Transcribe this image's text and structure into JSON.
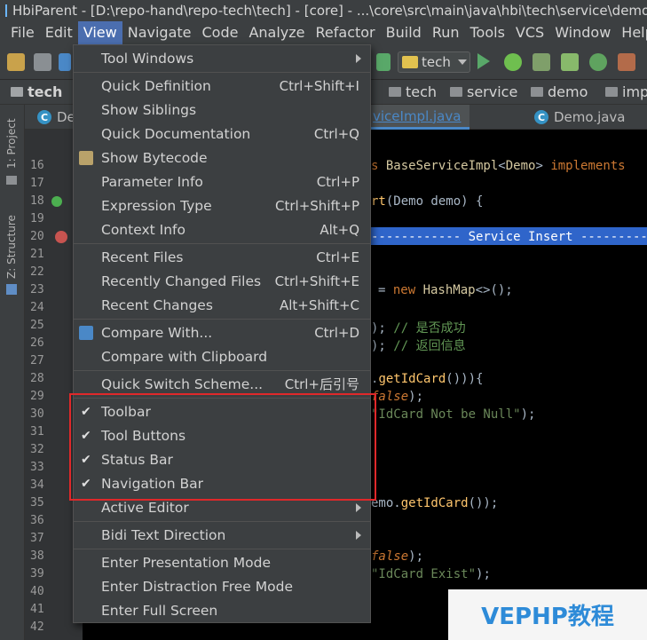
{
  "window": {
    "title": "HbiParent - [D:\\repo-hand\\repo-tech\\tech] - [core] - ...\\core\\src\\main\\java\\hbi\\tech\\service\\demo"
  },
  "menubar": [
    "File",
    "Edit",
    "View",
    "Navigate",
    "Code",
    "Analyze",
    "Refactor",
    "Build",
    "Run",
    "Tools",
    "VCS",
    "Window",
    "Help"
  ],
  "toolbar": {
    "run_config": "tech"
  },
  "navbar": {
    "root": "tech",
    "crumbs": [
      "tech",
      "service",
      "demo",
      "imp"
    ]
  },
  "tabs": [
    {
      "label": "De"
    },
    {
      "label": "viceImpl.java"
    },
    {
      "label": "Demo.java"
    }
  ],
  "tool_windows": {
    "project": "1: Project",
    "structure": "Z: Structure"
  },
  "gutter": {
    "lines": [
      "16",
      "17",
      "18",
      "19",
      "20",
      "21",
      "22",
      "23",
      "24",
      "25",
      "26",
      "27",
      "28",
      "29",
      "30",
      "31",
      "32",
      "33",
      "34",
      "35",
      "36",
      "37",
      "38",
      "39",
      "40",
      "41",
      "42"
    ]
  },
  "code": {
    "l16": {
      "a": "s ",
      "b": "BaseServiceImpl",
      "c": "<",
      "d": "Demo",
      "e": "> ",
      "f": "implements"
    },
    "l18": {
      "a": "rt",
      "b": "(Demo demo) {"
    },
    "l20": "------------ Service Insert -----------",
    "l23": {
      "a": "= ",
      "b": "new ",
      "c": "HashMap",
      "d": "<>();"
    },
    "l25": {
      "a": "); ",
      "b": "// 是否成功"
    },
    "l26": {
      "a": "); ",
      "b": "// 返回信息"
    },
    "l28": {
      "a": ".",
      "b": "getIdCard",
      "c": "())){"
    },
    "l29": {
      "a": "false",
      "b": ");"
    },
    "l30": {
      "a": "\"IdCard Not be Null\"",
      "b": ");"
    },
    "l35": {
      "a": "emo.",
      "b": "getIdCard",
      "c": "());"
    },
    "l39": {
      "a": "false",
      "b": ");"
    },
    "l40": {
      "a": "\"IdCard Exist\"",
      "b": ");"
    }
  },
  "view_menu": {
    "tool_windows": "Tool Windows",
    "quick_definition": "Quick Definition",
    "quick_definition_sc": "Ctrl+Shift+I",
    "show_siblings": "Show Siblings",
    "quick_documentation": "Quick Documentation",
    "quick_documentation_sc": "Ctrl+Q",
    "show_bytecode": "Show Bytecode",
    "parameter_info": "Parameter Info",
    "parameter_info_sc": "Ctrl+P",
    "expression_type": "Expression Type",
    "expression_type_sc": "Ctrl+Shift+P",
    "context_info": "Context Info",
    "context_info_sc": "Alt+Q",
    "recent_files": "Recent Files",
    "recent_files_sc": "Ctrl+E",
    "recently_changed_files": "Recently Changed Files",
    "recently_changed_files_sc": "Ctrl+Shift+E",
    "recent_changes": "Recent Changes",
    "recent_changes_sc": "Alt+Shift+C",
    "compare_with": "Compare With...",
    "compare_with_sc": "Ctrl+D",
    "compare_with_clipboard": "Compare with Clipboard",
    "quick_switch_scheme": "Quick Switch Scheme...",
    "quick_switch_scheme_sc": "Ctrl+后引号",
    "toolbar": "Toolbar",
    "tool_buttons": "Tool Buttons",
    "status_bar": "Status Bar",
    "navigation_bar": "Navigation Bar",
    "active_editor": "Active Editor",
    "bidi_text_direction": "Bidi Text Direction",
    "enter_presentation_mode": "Enter Presentation Mode",
    "enter_distraction_free_mode": "Enter Distraction Free Mode",
    "enter_full_screen": "Enter Full Screen"
  },
  "watermark": "VEPHP教程"
}
